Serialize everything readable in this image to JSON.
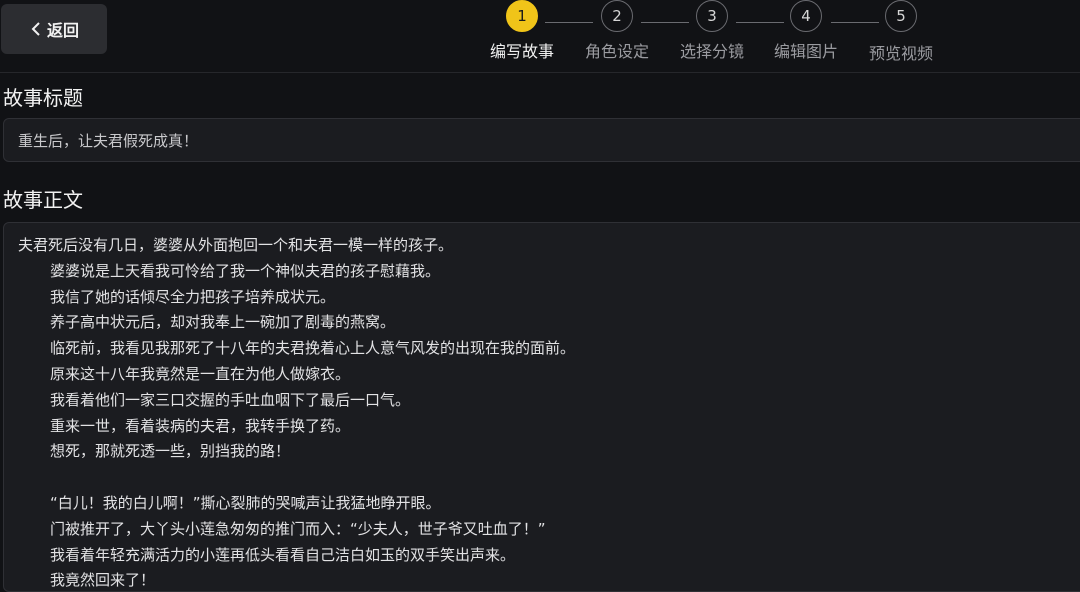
{
  "header": {
    "back_label": "返回",
    "steps": [
      {
        "number": "1",
        "label": "编写故事",
        "active": true
      },
      {
        "number": "2",
        "label": "角色设定",
        "active": false
      },
      {
        "number": "3",
        "label": "选择分镜",
        "active": false
      },
      {
        "number": "4",
        "label": "编辑图片",
        "active": false
      },
      {
        "number": "5",
        "label": "预览视频",
        "active": false
      }
    ]
  },
  "form": {
    "title_label": "故事标题",
    "title_value": "重生后，让夫君假死成真！",
    "body_label": "故事正文",
    "body_lines": [
      {
        "text": "夫君死后没有几日，婆婆从外面抱回一个和夫君一模一样的孩子。",
        "indent": false
      },
      {
        "text": "婆婆说是上天看我可怜给了我一个神似夫君的孩子慰藉我。",
        "indent": true
      },
      {
        "text": "我信了她的话倾尽全力把孩子培养成状元。",
        "indent": true
      },
      {
        "text": "养子高中状元后，却对我奉上一碗加了剧毒的燕窝。",
        "indent": true
      },
      {
        "text": "临死前，我看见我那死了十八年的夫君挽着心上人意气风发的出现在我的面前。",
        "indent": true
      },
      {
        "text": "原来这十八年我竟然是一直在为他人做嫁衣。",
        "indent": true
      },
      {
        "text": "我看着他们一家三口交握的手吐血咽下了最后一口气。",
        "indent": true
      },
      {
        "text": "重来一世，看着装病的夫君，我转手换了药。",
        "indent": true
      },
      {
        "text": "想死，那就死透一些，别挡我的路！",
        "indent": true
      },
      {
        "text": "",
        "indent": false
      },
      {
        "text": "“白儿！我的白儿啊！”撕心裂肺的哭喊声让我猛地睁开眼。",
        "indent": true
      },
      {
        "text": "门被推开了，大丫头小莲急匆匆的推门而入：“少夫人，世子爷又吐血了！”",
        "indent": true
      },
      {
        "text": "我看着年轻充满活力的小莲再低头看看自己洁白如玉的双手笑出声来。",
        "indent": true
      },
      {
        "text": "我竟然回来了！",
        "indent": true
      }
    ]
  }
}
